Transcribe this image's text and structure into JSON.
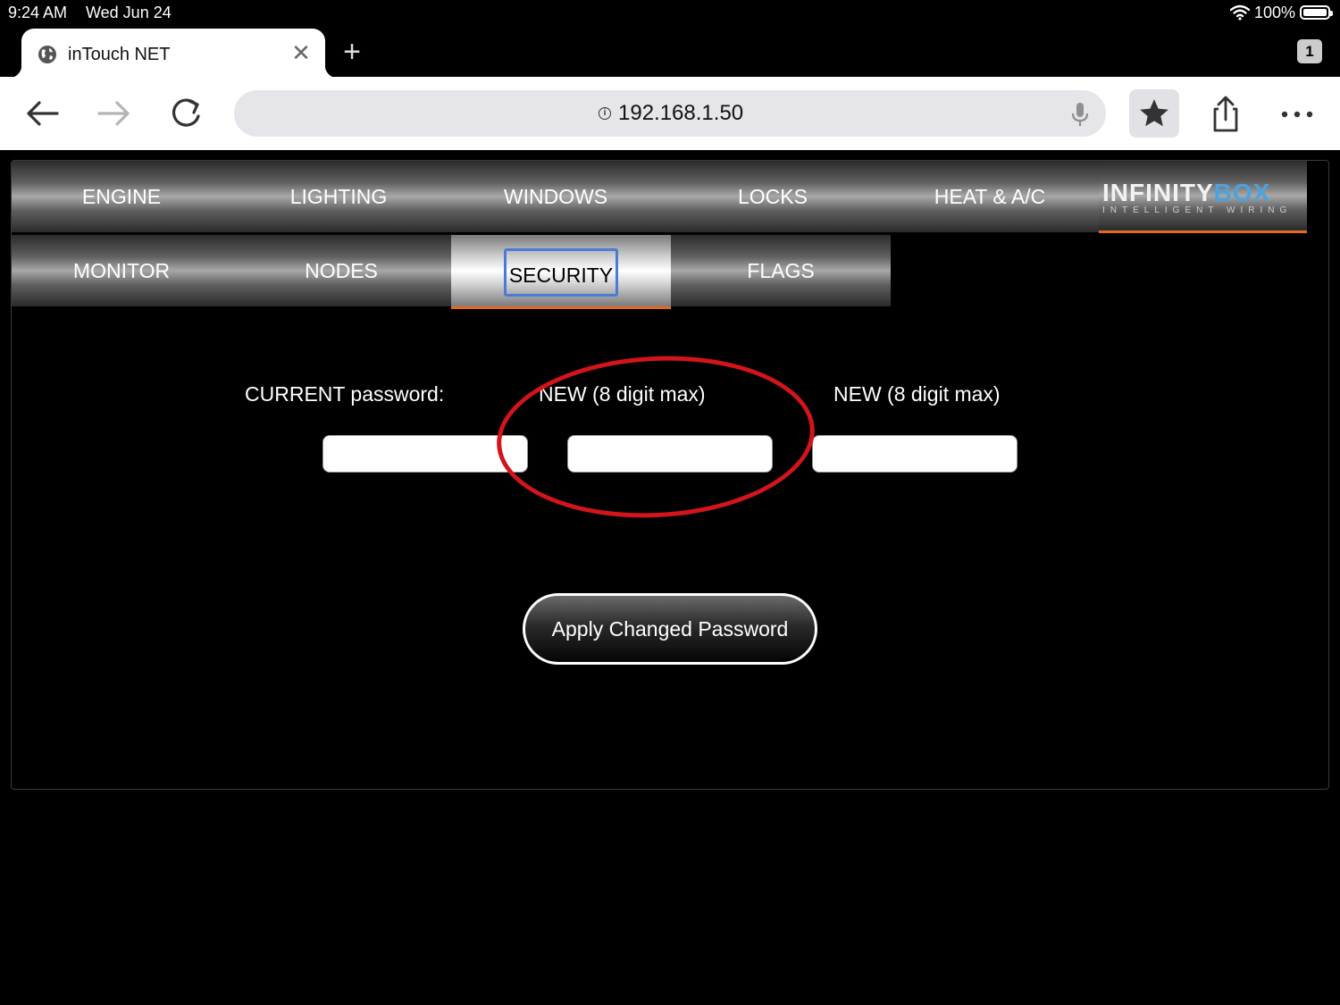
{
  "status_bar": {
    "time": "9:24 AM",
    "date": "Wed Jun 24",
    "battery": "100%"
  },
  "browser": {
    "tab_title": "inTouch NET",
    "tab_close": "✕",
    "new_tab": "+",
    "tab_count": "1",
    "url": "192.168.1.50"
  },
  "app": {
    "menu_row1": [
      "ENGINE",
      "LIGHTING",
      "WINDOWS",
      "LOCKS",
      "HEAT & A/C"
    ],
    "menu_row2": [
      "MONITOR",
      "NODES",
      "SECURITY",
      "FLAGS"
    ],
    "active_menu": "SECURITY",
    "logo": {
      "brand_main": "INFINITY",
      "brand_accent": "BOX",
      "tagline": "INTELLIGENT WIRING"
    },
    "labels": {
      "current": "CURRENT password:",
      "new1": "NEW (8 digit max)",
      "new2": "NEW (8 digit max)"
    },
    "inputs": {
      "current_value": "",
      "new1_value": "",
      "new2_value": ""
    },
    "apply_button": "Apply Changed Password"
  },
  "colors": {
    "accent": "#e66a1e",
    "focus": "#4a7bd6",
    "annotation": "#d3141b",
    "logo_accent": "#4aa3e0"
  }
}
